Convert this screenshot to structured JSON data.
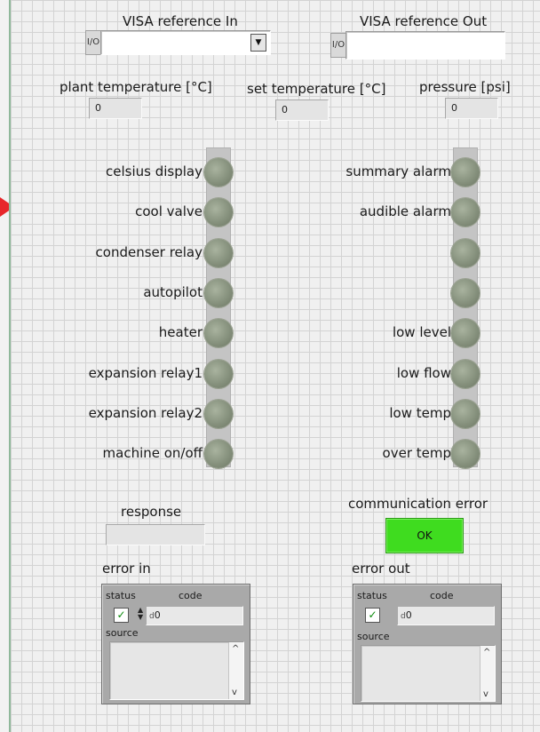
{
  "visa_in": {
    "label": "VISA reference In",
    "icon": "I/O",
    "value": ""
  },
  "visa_out": {
    "label": "VISA reference Out",
    "icon": "I/O",
    "value": ""
  },
  "plant_temperature": {
    "label": "plant temperature [°C]",
    "value": "0"
  },
  "set_temperature": {
    "label": "set temperature [°C]",
    "value": "0"
  },
  "pressure": {
    "label": "pressure [psi]",
    "value": "0"
  },
  "left_leds": [
    {
      "label": "celsius display",
      "on": false
    },
    {
      "label": "cool valve",
      "on": false
    },
    {
      "label": "condenser relay",
      "on": false
    },
    {
      "label": "autopilot",
      "on": false
    },
    {
      "label": "heater",
      "on": false
    },
    {
      "label": "expansion relay1",
      "on": false
    },
    {
      "label": "expansion relay2",
      "on": false
    },
    {
      "label": "machine on/off",
      "on": false
    }
  ],
  "right_leds": [
    {
      "label": "summary alarm",
      "on": false
    },
    {
      "label": "audible alarm",
      "on": false
    },
    {
      "label": "",
      "on": false
    },
    {
      "label": "",
      "on": false
    },
    {
      "label": "low level",
      "on": false
    },
    {
      "label": "low flow",
      "on": false
    },
    {
      "label": "low temp",
      "on": false
    },
    {
      "label": "over temp",
      "on": false
    }
  ],
  "response": {
    "label": "response",
    "value": ""
  },
  "communication_error": {
    "label": "communication error",
    "button_label": "OK",
    "color": "#3fdc1f"
  },
  "error_in": {
    "label": "error in",
    "status_label": "status",
    "code_label": "code",
    "code_value": "0",
    "code_prefix": "d",
    "source_label": "source",
    "status_checked": true
  },
  "error_out": {
    "label": "error out",
    "status_label": "status",
    "code_label": "code",
    "code_value": "0",
    "code_prefix": "d",
    "source_label": "source",
    "status_checked": true
  },
  "colors": {
    "led_off": "#86917d",
    "ok_green": "#3fdc1f",
    "arrow": "#e8262a"
  }
}
